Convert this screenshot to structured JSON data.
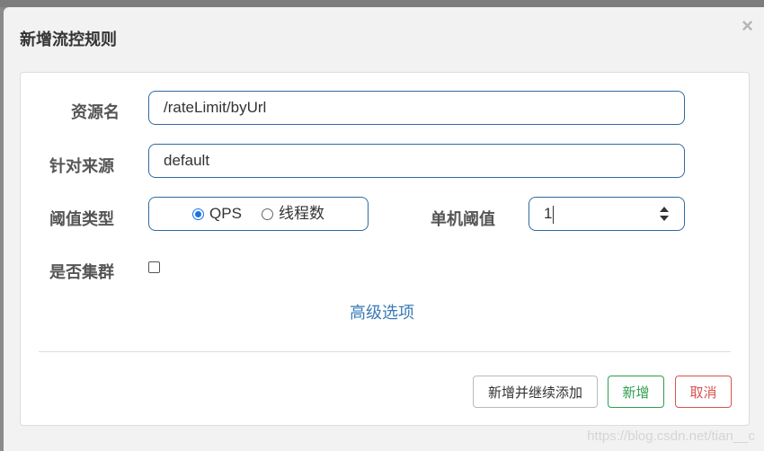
{
  "dialog": {
    "title": "新增流控规则",
    "close_glyph": "×"
  },
  "form": {
    "resource_name_label": "资源名",
    "resource_name_value": "/rateLimit/byUrl",
    "limit_app_label": "针对来源",
    "limit_app_value": "default",
    "threshold_type_label": "阈值类型",
    "threshold_type_options": [
      {
        "label": "QPS",
        "checked": true
      },
      {
        "label": "线程数",
        "checked": false
      }
    ],
    "single_threshold_label": "单机阈值",
    "single_threshold_value": "1",
    "cluster_label": "是否集群",
    "cluster_checked": false,
    "advanced_link": "高级选项"
  },
  "buttons": {
    "add_and_continue": "新增并继续添加",
    "add": "新增",
    "cancel": "取消"
  },
  "watermark": "https://blog.csdn.net/tian__c",
  "colors": {
    "field_border": "#2f6aa3",
    "link": "#3a7bb7",
    "success": "#2e9e4c",
    "danger": "#d9534f"
  }
}
